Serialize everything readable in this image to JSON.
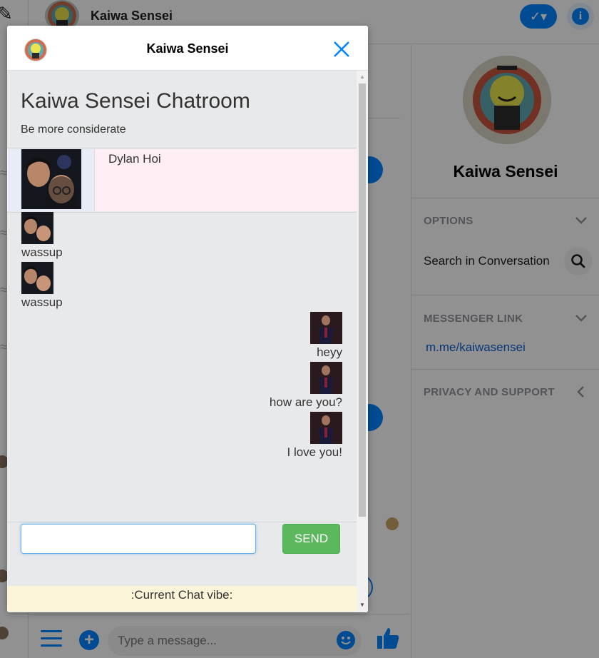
{
  "messenger": {
    "contact_name": "Kaiwa Sensei",
    "compose_glyph": "✎",
    "check_glyph": "✓▾",
    "info_glyph": "i",
    "right_panel": {
      "name": "Kaiwa Sensei",
      "options_title": "OPTIONS",
      "search_label": "Search in Conversation",
      "link_title": "MESSENGER LINK",
      "link_url": "m.me/kaiwasensei",
      "privacy_title": "PRIVACY AND SUPPORT"
    },
    "composer": {
      "placeholder": "Type a message...",
      "plus_glyph": "+"
    },
    "icons": [
      "compose-icon",
      "check-icon",
      "info-icon",
      "chevron-down-icon",
      "chevron-left-icon",
      "search-icon",
      "menu-icon",
      "plus-icon",
      "emoji-icon",
      "thumbs-up-icon"
    ]
  },
  "modal": {
    "title": "Kaiwa Sensei",
    "chatroom_title": "Kaiwa Sensei Chatroom",
    "subtitle": "Be more considerate",
    "user_name": "Dylan Hoi",
    "messages": [
      {
        "side": "left",
        "text": "wassup"
      },
      {
        "side": "left",
        "text": "wassup"
      },
      {
        "side": "right",
        "text": "heyy"
      },
      {
        "side": "right",
        "text": "how are you?"
      },
      {
        "side": "right",
        "text": "I love you!"
      }
    ],
    "input_value": "",
    "send_label": "SEND",
    "vibe_label": ":Current Chat vibe:"
  },
  "colors": {
    "messenger_blue": "#0084ff",
    "send_green": "#5cb85c",
    "user_card_pink": "#ffeef3",
    "vibe_yellow": "#fcf5da",
    "link_blue": "#0b5fd1"
  }
}
